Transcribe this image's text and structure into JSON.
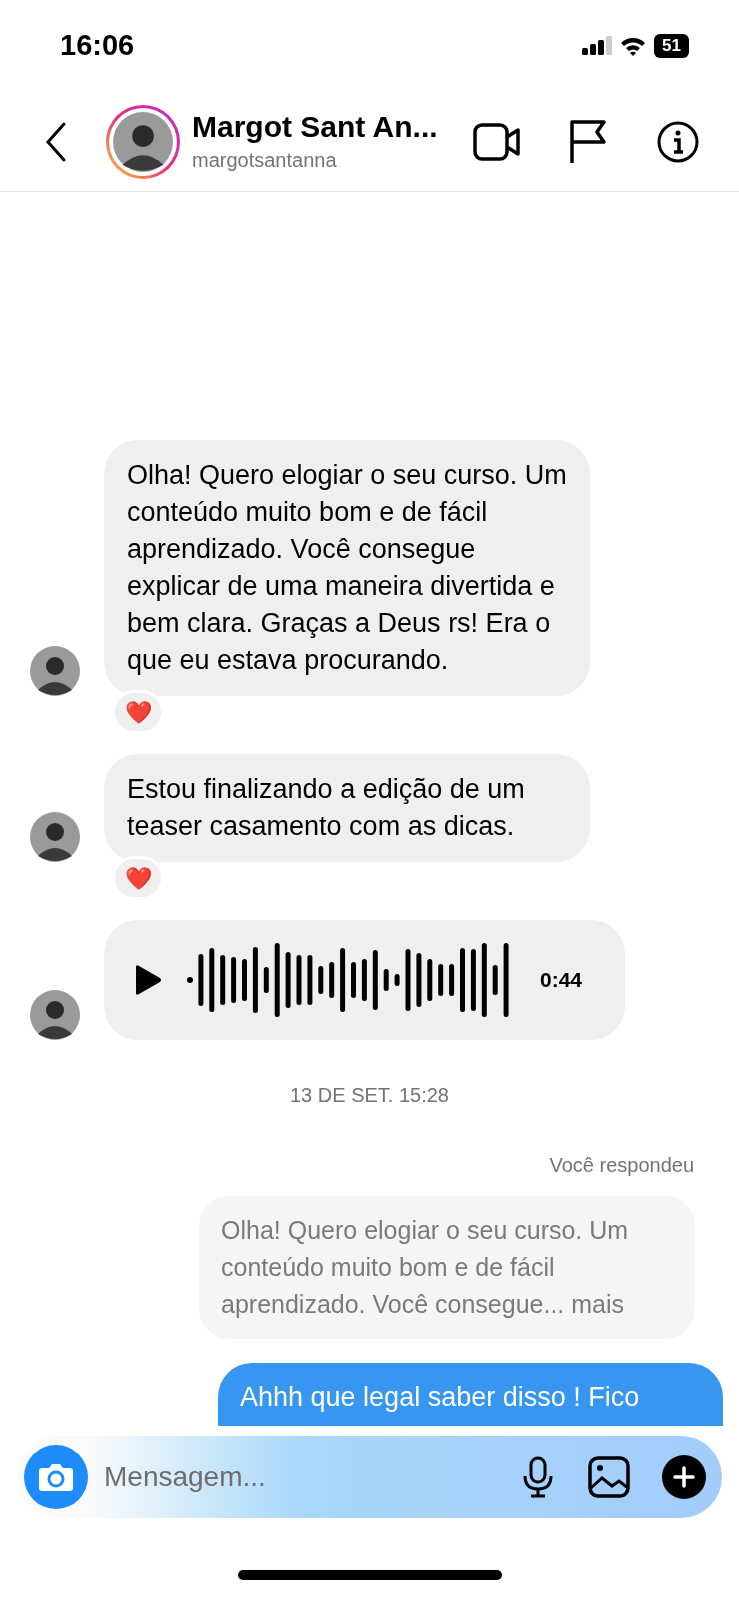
{
  "status_bar": {
    "time": "16:06",
    "battery": "51"
  },
  "header": {
    "name": "Margot Sant An...",
    "username": "margotsantanna"
  },
  "messages": [
    {
      "kind": "text",
      "text": "Olha! Quero elogiar o seu curso. Um conteúdo muito bom e de fácil aprendizado. Você consegue explicar de uma maneira divertida e bem clara. Graças a Deus rs! Era o que eu estava procurando.",
      "reaction": "❤️"
    },
    {
      "kind": "text",
      "text": "Estou finalizando a edição de um teaser casamento com as dicas.",
      "reaction": "❤️"
    },
    {
      "kind": "audio",
      "duration": "0:44"
    }
  ],
  "timestamp": "13 DE SET. 15:28",
  "reply": {
    "label": "Você respondeu",
    "quoted": "Olha! Quero elogiar o seu curso. Um conteúdo muito bom e de fácil aprendizado. Você consegue... mais",
    "text": "Ahhh que legal saber disso ! Fico"
  },
  "composer": {
    "placeholder": "Mensagem..."
  }
}
